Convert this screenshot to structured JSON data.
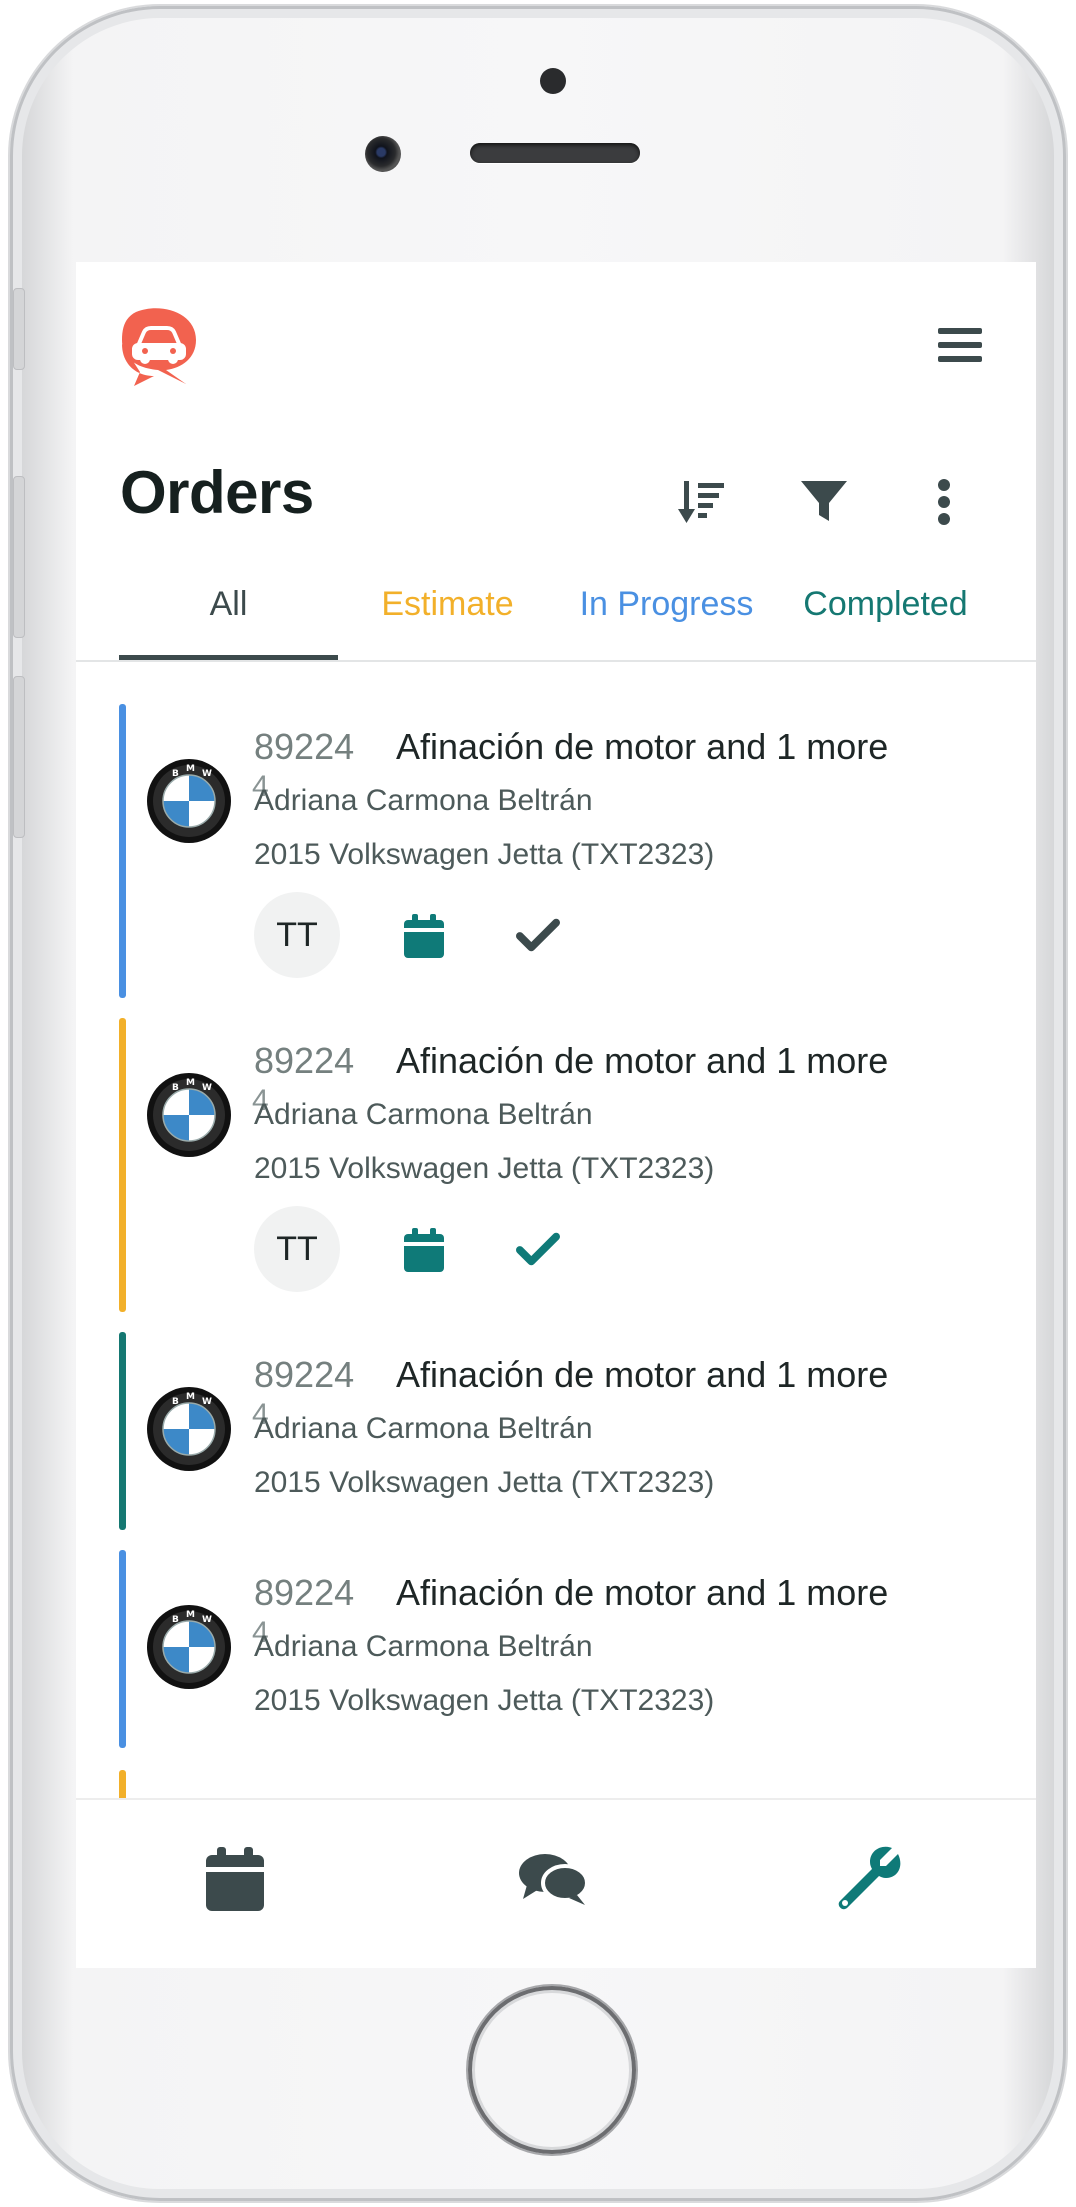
{
  "app": {
    "page_title": "Orders"
  },
  "icons": {
    "logo": "car-chat-logo",
    "menu": "hamburger-menu-icon",
    "sort": "sort-icon",
    "filter": "filter-icon",
    "more": "more-vertical-icon",
    "calendar": "calendar-icon",
    "check": "check-icon",
    "chat": "chat-icon",
    "wrench": "wrench-icon",
    "brand": "bmw-logo"
  },
  "colors": {
    "primary_dark": "#3c4a4c",
    "teal": "#0f7a78",
    "estimate": "#f2b02a",
    "in_progress": "#4a90e2",
    "completed": "#157872",
    "logo_red": "#f2624f"
  },
  "tabs": [
    {
      "label": "All",
      "active": true,
      "color": "#3c4a4c"
    },
    {
      "label": "Estimate",
      "active": false,
      "color": "#f2b02a"
    },
    {
      "label": "In Progress",
      "active": false,
      "color": "#4a90e2"
    },
    {
      "label": "Completed",
      "active": false,
      "color": "#157872"
    }
  ],
  "orders": [
    {
      "number": "89224",
      "title": "Afinación de motor and 1 more",
      "digit": "4",
      "customer": "Adriana Carmona Beltrán",
      "vehicle": "2015 Volkswagen Jetta (TXT2323)",
      "status_color": "#4a90e2",
      "avatar": "TT",
      "check_color": "#3c4a4c"
    },
    {
      "number": "89224",
      "title": "Afinación de motor and 1 more",
      "digit": "4",
      "customer": "Adriana Carmona Beltrán",
      "vehicle": "2015 Volkswagen Jetta (TXT2323)",
      "status_color": "#f2b02a",
      "avatar": "TT",
      "check_color": "#0f7a78"
    },
    {
      "number": "89224",
      "title": "Afinación de motor and 1 more",
      "digit": "4",
      "customer": "Adriana Carmona Beltrán",
      "vehicle": "2015 Volkswagen Jetta (TXT2323)",
      "status_color": "#157872"
    },
    {
      "number": "89224",
      "title": "Afinación de motor and 1 more",
      "digit": "4",
      "customer": "Adriana Carmona Beltrán",
      "vehicle": "2015 Volkswagen Jetta (TXT2323)",
      "status_color": "#4a90e2"
    }
  ],
  "bottom_nav": [
    {
      "icon": "calendar-icon",
      "active": false
    },
    {
      "icon": "chat-icon",
      "active": false
    },
    {
      "icon": "wrench-icon",
      "active": true
    }
  ]
}
